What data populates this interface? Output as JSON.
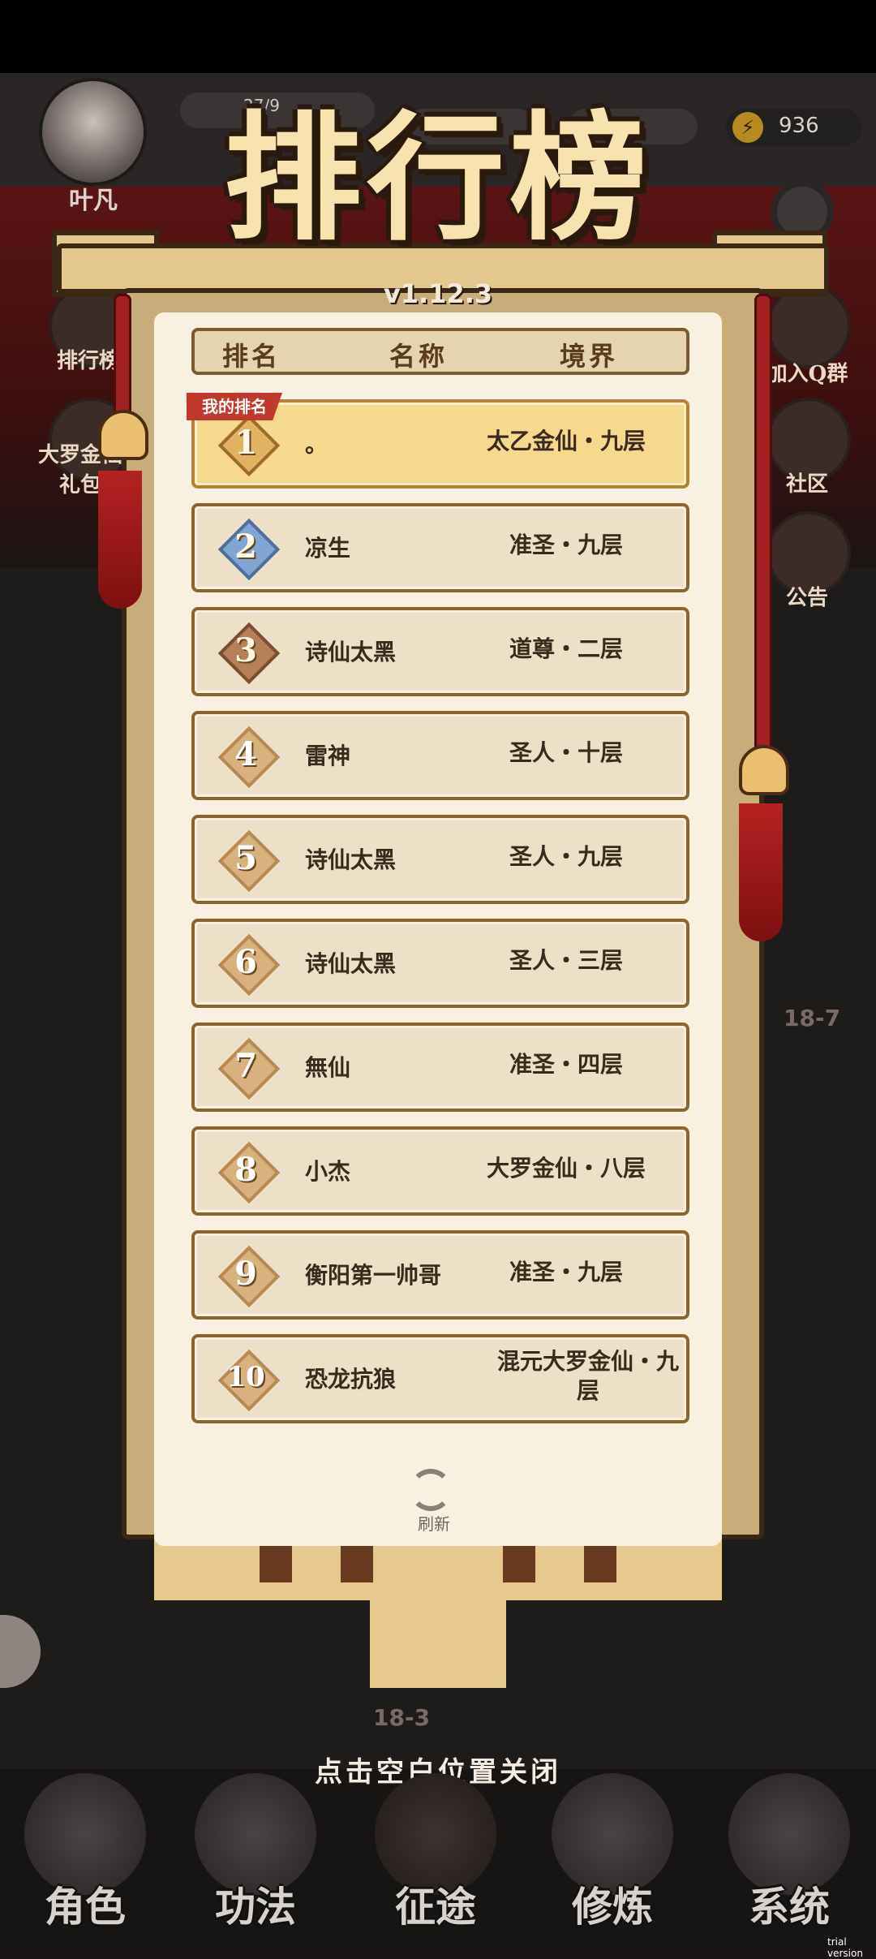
{
  "hud": {
    "player_name": "叶凡",
    "exp_text": "27/9",
    "energy": "936",
    "energy_icon": "lightning-icon"
  },
  "side_left": [
    {
      "label": "排行榜",
      "icon": "leaderboard-icon"
    },
    {
      "label": "大罗金仙礼包",
      "icon": "gift-icon"
    }
  ],
  "side_right": [
    {
      "label": "加入Q群",
      "icon": "penguin-icon"
    },
    {
      "label": "社区",
      "icon": "chat-icon"
    },
    {
      "label": "公告",
      "icon": "megaphone-icon"
    }
  ],
  "stage_labels": [
    "18-7",
    "18-3"
  ],
  "leaderboard": {
    "title": "排行榜",
    "version": "v1.12.3",
    "headers": {
      "rank": "排名",
      "name": "名称",
      "realm": "境界"
    },
    "my_rank_tag": "我的排名",
    "rows": [
      {
        "rank": "1",
        "name": "。",
        "realm": "太乙金仙・九层",
        "mine": true
      },
      {
        "rank": "2",
        "name": "凉生",
        "realm": "准圣・九层"
      },
      {
        "rank": "3",
        "name": "诗仙太黑",
        "realm": "道尊・二层"
      },
      {
        "rank": "4",
        "name": "雷神",
        "realm": "圣人・十层"
      },
      {
        "rank": "5",
        "name": "诗仙太黑",
        "realm": "圣人・九层"
      },
      {
        "rank": "6",
        "name": "诗仙太黑",
        "realm": "圣人・三层"
      },
      {
        "rank": "7",
        "name": "無仙",
        "realm": "准圣・四层"
      },
      {
        "rank": "8",
        "name": "小杰",
        "realm": "大罗金仙・八层"
      },
      {
        "rank": "9",
        "name": "衡阳第一帅哥",
        "realm": "准圣・九层"
      },
      {
        "rank": "10",
        "name": "恐龙抗狼",
        "realm": "混元大罗金仙・九层"
      }
    ],
    "refresh_label": "刷新"
  },
  "close_hint": "点击空白位置关闭",
  "nav": [
    {
      "label": "角色",
      "icon": "character-icon"
    },
    {
      "label": "功法",
      "icon": "book-icon"
    },
    {
      "label": "征途",
      "icon": "sword-icon"
    },
    {
      "label": "修炼",
      "icon": "meditation-icon"
    },
    {
      "label": "系统",
      "icon": "system-icon"
    }
  ],
  "watermark": "trial version"
}
